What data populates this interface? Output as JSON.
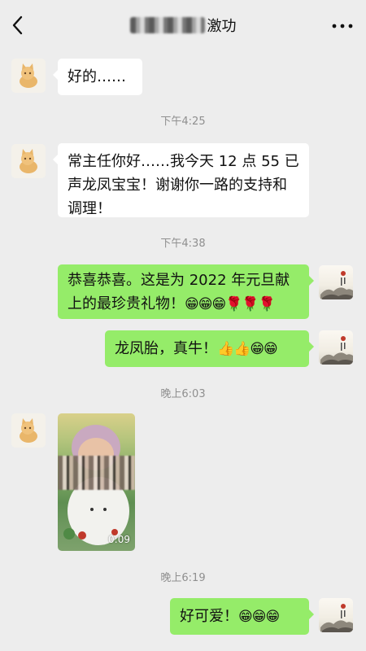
{
  "header": {
    "title_suffix": "激功",
    "back_icon": "chevron-left-icon",
    "more_icon": "more-dots-icon"
  },
  "messages": [
    {
      "side": "left",
      "text": "好的……"
    },
    {
      "time": "下午4:25"
    },
    {
      "side": "left",
      "text": "常主任你好……我今天 12 点 55 已声龙凤宝宝！谢谢你一路的支持和调理！"
    },
    {
      "time": "下午4:38"
    },
    {
      "side": "right",
      "text": "恭喜恭喜。这是为 2022 年元旦献上的最珍贵礼物！",
      "emoji": "😁😁😁🌹🌹🌹"
    },
    {
      "side": "right",
      "text": "龙凤胎，真牛！",
      "emoji": "👍👍😁😁"
    },
    {
      "time": "晚上6:03"
    },
    {
      "side": "left",
      "type": "video",
      "duration": "0:09"
    },
    {
      "time": "晚上6:19"
    },
    {
      "side": "right",
      "text": "好可爱！",
      "emoji": "😁😁😁"
    }
  ],
  "colors": {
    "background": "#ededed",
    "sent_bubble": "#95ec69",
    "received_bubble": "#ffffff",
    "timestamp": "#8f8f8f"
  }
}
